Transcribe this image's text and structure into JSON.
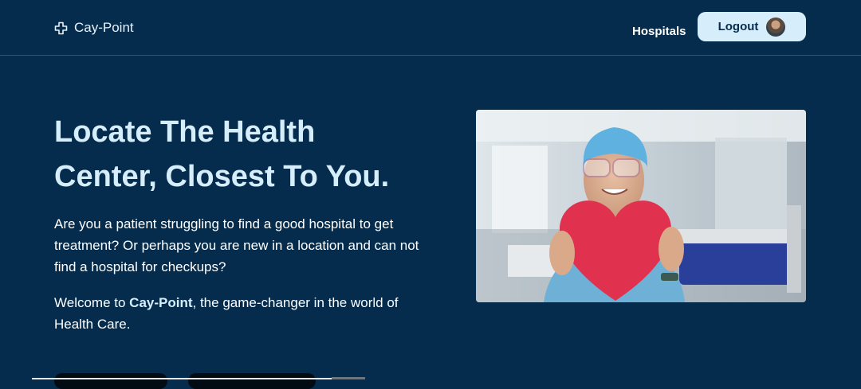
{
  "nav": {
    "brand": "Cay-Point",
    "link": "Hospitals",
    "logout_label": "Logout"
  },
  "hero": {
    "title_line1": "Locate The Health",
    "title_line2": "Center, Closest To You.",
    "paragraph1": "Are you a patient struggling to find a good hospital to get treatment? Or perhaps you are new in a location and can not find a hospital for checkups?",
    "paragraph2_prefix": "Welcome to ",
    "paragraph2_brand": "Cay-Point",
    "paragraph2_suffix": ", the game-changer in the world of Health Care."
  },
  "colors": {
    "background": "#052c4c",
    "accent": "#d6eefb",
    "heart": "#e0314f"
  },
  "icons": {
    "brand_icon": "medical-cross-icon"
  }
}
